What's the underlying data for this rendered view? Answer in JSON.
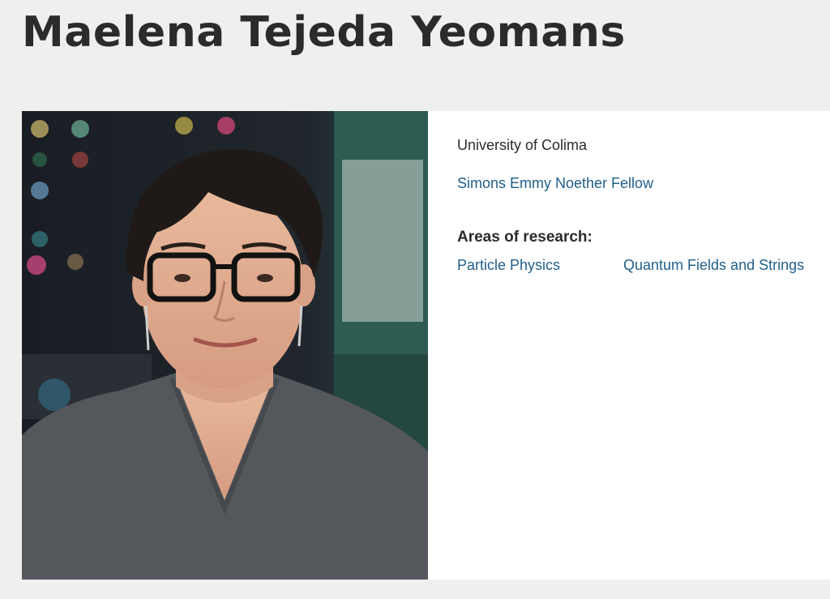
{
  "person": {
    "name": "Maelena Tejeda Yeomans",
    "institution": "University of Colima",
    "fellowship": "Simons Emmy Noether Fellow",
    "areas_heading": "Areas of research:",
    "areas": [
      {
        "label": "Particle Physics"
      },
      {
        "label": "Quantum Fields and Strings"
      }
    ]
  },
  "colors": {
    "page_background": "#efefef",
    "card_background": "#ffffff",
    "text": "#2b2b2b",
    "link": "#1f5f8b"
  }
}
